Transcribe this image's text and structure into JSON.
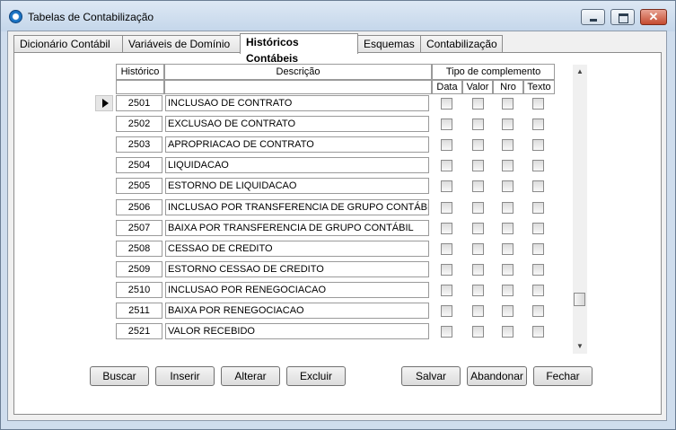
{
  "window": {
    "title": "Tabelas de Contabilização"
  },
  "tabs": [
    {
      "label": "Dicionário Contábil"
    },
    {
      "label": "Variáveis de Domínio"
    },
    {
      "label": "Históricos Contábeis"
    },
    {
      "label": "Esquemas"
    },
    {
      "label": "Contabilização"
    }
  ],
  "active_tab": "Históricos Contábeis",
  "grid": {
    "headers": {
      "historico": "Histórico",
      "descricao": "Descrição",
      "tipo_complemento": "Tipo de complemento",
      "data": "Data",
      "valor": "Valor",
      "nro": "Nro",
      "texto": "Texto"
    },
    "rows": [
      {
        "code": "2501",
        "desc": "INCLUSAO DE CONTRATO"
      },
      {
        "code": "2502",
        "desc": "EXCLUSAO DE CONTRATO"
      },
      {
        "code": "2503",
        "desc": "APROPRIACAO DE CONTRATO"
      },
      {
        "code": "2504",
        "desc": "LIQUIDACAO"
      },
      {
        "code": "2505",
        "desc": "ESTORNO DE LIQUIDACAO"
      },
      {
        "code": "2506",
        "desc": "INCLUSAO POR TRANSFERENCIA DE GRUPO CONTÁBIL"
      },
      {
        "code": "2507",
        "desc": "BAIXA POR TRANSFERENCIA DE GRUPO CONTÁBIL"
      },
      {
        "code": "2508",
        "desc": "CESSAO DE CREDITO"
      },
      {
        "code": "2509",
        "desc": "ESTORNO CESSAO DE CREDITO"
      },
      {
        "code": "2510",
        "desc": "INCLUSAO POR RENEGOCIACAO"
      },
      {
        "code": "2511",
        "desc": "BAIXA POR RENEGOCIACAO"
      },
      {
        "code": "2521",
        "desc": "VALOR RECEBIDO"
      }
    ]
  },
  "buttons": {
    "buscar": "Buscar",
    "inserir": "Inserir",
    "alterar": "Alterar",
    "excluir": "Excluir",
    "salvar": "Salvar",
    "abandonar": "Abandonar",
    "fechar": "Fechar"
  }
}
